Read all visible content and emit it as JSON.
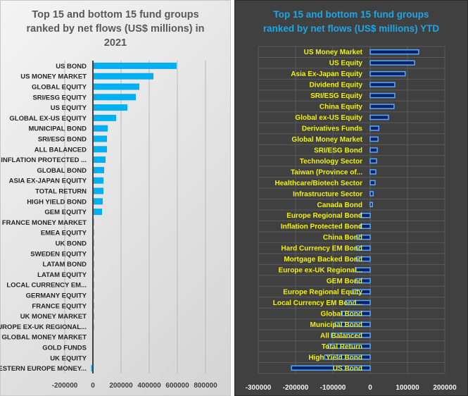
{
  "chart_data": [
    {
      "type": "bar",
      "orientation": "horizontal",
      "title": "Top 15 and bottom 15 fund groups ranked by net flows (US$ millions) in 2021",
      "title_lines": [
        "Top 15 and bottom 15 fund groups",
        "ranked by net flows (US$ millions) in",
        "2021"
      ],
      "categories": [
        "US BOND",
        "US MONEY MARKET",
        "GLOBAL EQUITY",
        "SRI/ESG EQUITY",
        "US EQUITY",
        "GLOBAL EX-US EQUITY",
        "MUNICIPAL BOND",
        "SRI/ESG BOND",
        "ALL BALANCED",
        "INFLATION PROTECTED ...",
        "GLOBAL BOND",
        "ASIA EX-JAPAN EQUITY",
        "TOTAL RETURN",
        "HIGH YIELD BOND",
        "GEM EQUITY",
        "FRANCE MONEY MARKET",
        "EMEA EQUITY",
        "UK BOND",
        "SWEDEN EQUITY",
        "LATAM BOND",
        "LATAM EQUITY",
        "LOCAL CURRENCY EM...",
        "GERMANY EQUITY",
        "FRANCE EQUITY",
        "UK MONEY MARKET",
        "EUROPE EX-UK REGIONAL...",
        "GLOBAL MONEY MARKET",
        "GOLD FUNDS",
        "UK EQUITY",
        "WESTERN EUROPE MONEY..."
      ],
      "values": [
        595000,
        430000,
        330000,
        305000,
        245000,
        165000,
        105000,
        100000,
        100000,
        90000,
        80000,
        75000,
        75000,
        70000,
        65000,
        1500,
        1200,
        1000,
        900,
        800,
        700,
        600,
        500,
        400,
        300,
        -500,
        -2000,
        -2500,
        -5000,
        -12000
      ],
      "xlim": [
        -200000,
        800000
      ],
      "xticks": [
        "-200000",
        "0",
        "200000",
        "400000",
        "600000",
        "800000"
      ],
      "xtick_values": [
        -200000,
        0,
        200000,
        400000,
        600000,
        800000
      ],
      "grid": "vertical",
      "colors": {
        "bar": "#00b0f0",
        "title": "#595959",
        "background": "#e6e6e6"
      }
    },
    {
      "type": "bar",
      "orientation": "horizontal",
      "title": "Top 15 and bottom 15 fund groups ranked by net flows (US$ millions) YTD",
      "title_lines": [
        "Top 15 and bottom 15 fund groups",
        "ranked by net flows (US$ millions) YTD"
      ],
      "categories": [
        "US Money Market",
        "US Equity",
        "Asia Ex-Japan Equity",
        "Dividend Equity",
        "SRI/ESG Equity",
        "China Equity",
        "Global ex-US Equity",
        "Derivatives Funds",
        "Global Money Market",
        "SRI/ESG Bond",
        "Technology Sector",
        "Taiwan (Province of...",
        "Healthcare/Biotech Sector",
        "Infrastructure Sector",
        "Canada Bond",
        "Europe Regional Bond",
        "Inflation Protected Bond",
        "China Bond",
        "Hard Currency EM Bond",
        "Mortgage Backed Bond",
        "Europe ex-UK Regional...",
        "GEM Bond",
        "Europe Regional Equity",
        "Local Currency EM Bond...",
        "Global Bond",
        "Municipal Bond",
        "All Balanced",
        "Total Return",
        "High Yield Bond",
        "US Bond"
      ],
      "values": [
        130000,
        119000,
        94000,
        66000,
        66000,
        64000,
        49000,
        23000,
        21000,
        19000,
        17000,
        15000,
        13000,
        8000,
        6000,
        -25000,
        -26000,
        -36000,
        -37000,
        -37000,
        -38000,
        -39000,
        -47000,
        -66000,
        -75000,
        -94000,
        -104000,
        -113000,
        -122000,
        -211000
      ],
      "xlim": [
        -300000,
        200000
      ],
      "xticks": [
        "-300000",
        "-200000",
        "-100000",
        "0",
        "100000",
        "200000"
      ],
      "xtick_values": [
        -300000,
        -200000,
        -100000,
        0,
        100000,
        200000
      ],
      "grid": "both",
      "colors": {
        "bar": "#0a2266",
        "bar_outline": "#5aa8ff",
        "label": "#f2f200",
        "title": "#1ba6e6",
        "background": "#404040"
      }
    }
  ]
}
